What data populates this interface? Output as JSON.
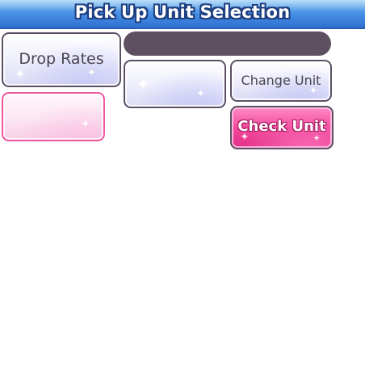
{
  "header": {
    "title": "Pick Up Unit Selection"
  },
  "buttons": {
    "drop_rates": "Drop Rates",
    "change_unit": "Change Unit",
    "check_unit": "Check Unit"
  },
  "unit_name": "",
  "colors": {
    "title_bar": "#4a93e6",
    "button_border": "#5c5066",
    "check_unit_fill": "#f24a9c",
    "pink_slot_border": "#f0569f",
    "name_bar": "#5e5061"
  }
}
